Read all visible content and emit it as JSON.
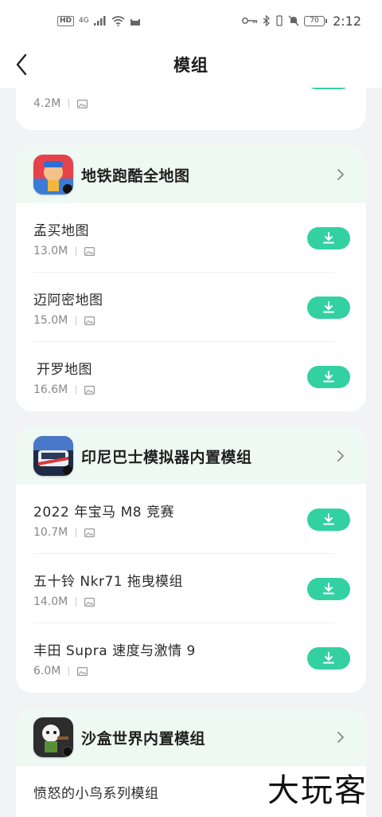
{
  "status_bar": {
    "left_badge": "HD",
    "net": "4G",
    "battery": "70",
    "time": "2:12"
  },
  "header": {
    "title": "模组"
  },
  "prev_item": {
    "size": "4.2M"
  },
  "cards": [
    {
      "title": "地铁跑酷全地图",
      "items": [
        {
          "name": "孟买地图",
          "size": "13.0M"
        },
        {
          "name": "迈阿密地图",
          "size": "15.0M"
        },
        {
          "name": "开罗地图",
          "size": "16.6M"
        }
      ]
    },
    {
      "title": "印尼巴士模拟器内置模组",
      "items": [
        {
          "name": "2022 年宝马 M8 竞赛",
          "size": "10.7M"
        },
        {
          "name": "五十铃 Nkr71 拖曳模组",
          "size": "14.0M"
        },
        {
          "name": "丰田 Supra 速度与激情 9",
          "size": "6.0M"
        }
      ]
    },
    {
      "title": "沙盒世界内置模组",
      "items": [
        {
          "name": "愤怒的小鸟系列模组"
        }
      ]
    }
  ],
  "watermark": "大玩客",
  "colors": {
    "accent": "#33d1a2",
    "card_head": "#eef9f4",
    "background": "#f2f3f5"
  }
}
